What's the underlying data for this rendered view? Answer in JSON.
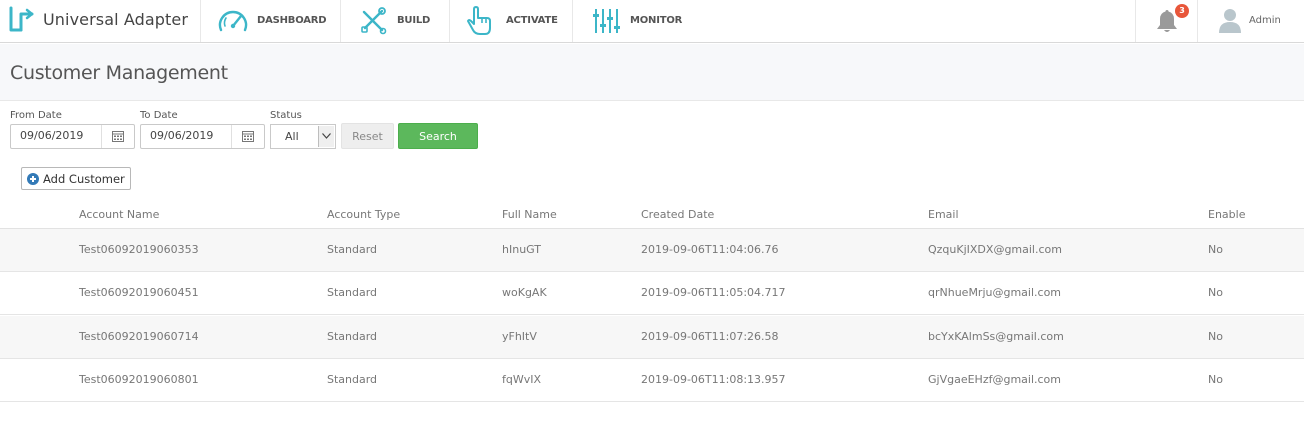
{
  "app": {
    "name": "Universal Adapter"
  },
  "nav": {
    "items": [
      {
        "label": "DASHBOARD",
        "icon": "speedometer-icon"
      },
      {
        "label": "BUILD",
        "icon": "wrench-screwdriver-icon"
      },
      {
        "label": "ACTIVATE",
        "icon": "tap-hand-icon"
      },
      {
        "label": "MONITOR",
        "icon": "equalizer-sliders-icon"
      }
    ],
    "notifications": {
      "icon": "bell-icon",
      "count": "3"
    },
    "user": {
      "name": "Admin",
      "icon": "user-avatar-icon"
    }
  },
  "page": {
    "title": "Customer Management"
  },
  "filters": {
    "from_date": {
      "label": "From Date",
      "value": "09/06/2019"
    },
    "to_date": {
      "label": "To Date",
      "value": "09/06/2019"
    },
    "status": {
      "label": "Status",
      "value": "All"
    },
    "reset_label": "Reset",
    "search_label": "Search"
  },
  "add_customer_label": "Add Customer",
  "table": {
    "columns": [
      "Account Name",
      "Account Type",
      "Full Name",
      "Created Date",
      "Email",
      "Enable"
    ],
    "rows": [
      [
        "Test06092019060353",
        "Standard",
        "hInuGT",
        "2019-09-06T11:04:06.76",
        "QzquKjIXDX@gmail.com",
        "No"
      ],
      [
        "Test06092019060451",
        "Standard",
        "woKgAK",
        "2019-09-06T11:05:04.717",
        "qrNhueMrju@gmail.com",
        "No"
      ],
      [
        "Test06092019060714",
        "Standard",
        "yFhItV",
        "2019-09-06T11:07:26.58",
        "bcYxKAlmSs@gmail.com",
        "No"
      ],
      [
        "Test06092019060801",
        "Standard",
        "fqWvIX",
        "2019-09-06T11:08:13.957",
        "GjVgaeEHzf@gmail.com",
        "No"
      ]
    ]
  },
  "colors": {
    "accent_teal": "#3cb6c8",
    "search_green": "#5cb85c",
    "badge_red": "#e8563a",
    "add_blue": "#337ab7"
  }
}
